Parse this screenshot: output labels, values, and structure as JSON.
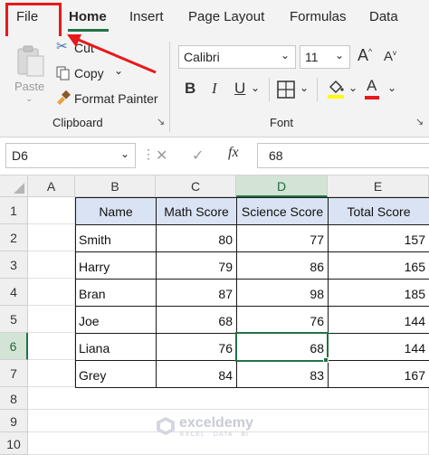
{
  "ribbon_tabs": [
    "File",
    "Home",
    "Insert",
    "Page Layout",
    "Formulas",
    "Data"
  ],
  "clipboard": {
    "paste_label": "Paste",
    "cut_label": "Cut",
    "copy_label": "Copy",
    "format_painter_label": "Format Painter",
    "group_label": "Clipboard"
  },
  "font": {
    "font_name": "Calibri",
    "font_size": "11",
    "bold": "B",
    "italic": "I",
    "underline": "U",
    "group_label": "Font"
  },
  "formula_bar": {
    "name_box": "D6",
    "cancel": "✕",
    "enter": "✓",
    "fx": "fx",
    "value": "68"
  },
  "columns": [
    "A",
    "B",
    "C",
    "D",
    "E"
  ],
  "rows": [
    "1",
    "2",
    "3",
    "4",
    "5",
    "6",
    "7",
    "8",
    "9",
    "10"
  ],
  "table": {
    "headers": [
      "Name",
      "Math Score",
      "Science Score",
      "Total Score"
    ],
    "rows": [
      {
        "name": "Smith",
        "math": "80",
        "science": "77",
        "total": "157"
      },
      {
        "name": "Harry",
        "math": "79",
        "science": "86",
        "total": "165"
      },
      {
        "name": "Bran",
        "math": "87",
        "science": "98",
        "total": "185"
      },
      {
        "name": "Joe",
        "math": "68",
        "science": "76",
        "total": "144"
      },
      {
        "name": "Liana",
        "math": "76",
        "science": "68",
        "total": "144"
      },
      {
        "name": "Grey",
        "math": "84",
        "science": "83",
        "total": "167"
      }
    ]
  },
  "watermark": {
    "name": "exceldemy",
    "tagline": "EXCEL · DATA · BI"
  },
  "colors": {
    "accent_green": "#217346",
    "highlight_red": "#e8191b",
    "table_header": "#dae3f3"
  }
}
